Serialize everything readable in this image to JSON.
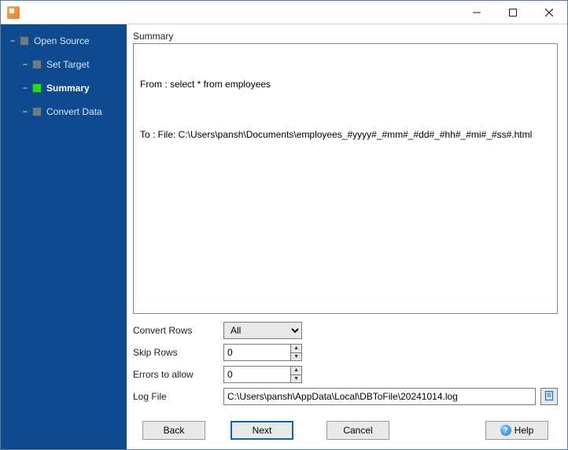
{
  "window": {
    "title": ""
  },
  "sidebar": {
    "root": {
      "label": "Open Source"
    },
    "items": [
      {
        "label": "Set Target",
        "active": false
      },
      {
        "label": "Summary",
        "active": true
      },
      {
        "label": "Convert Data",
        "active": false
      }
    ]
  },
  "main": {
    "section_label": "Summary",
    "from_line": "From : select * from employees",
    "to_line": "To : File: C:\\Users\\pansh\\Documents\\employees_#yyyy#_#mm#_#dd#_#hh#_#mi#_#ss#.html"
  },
  "form": {
    "convert_rows": {
      "label": "Convert Rows",
      "value": "All"
    },
    "skip_rows": {
      "label": "Skip Rows",
      "value": "0"
    },
    "errors_allow": {
      "label": "Errors to allow",
      "value": "0"
    },
    "log_file": {
      "label": "Log File",
      "value": "C:\\Users\\pansh\\AppData\\Local\\DBToFile\\20241014.log"
    }
  },
  "buttons": {
    "back": "Back",
    "next": "Next",
    "cancel": "Cancel",
    "help": "Help"
  }
}
